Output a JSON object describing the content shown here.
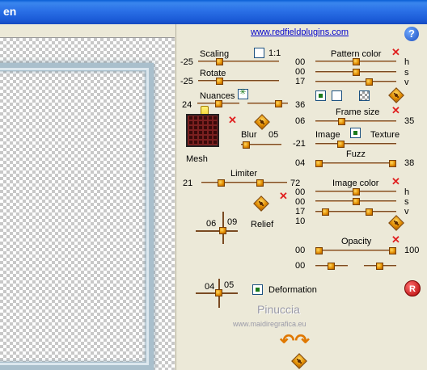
{
  "window": {
    "title": "en"
  },
  "header": {
    "link": "www.redfieldplugins.com",
    "help_label": "?"
  },
  "left": {
    "scaling": {
      "label": "Scaling",
      "min": "-25",
      "value": 0.48,
      "checkbox_label": "1:1"
    },
    "rotate": {
      "label": "Rotate",
      "min": "-25",
      "value": 0.48
    },
    "nuances": {
      "label": "Nuances",
      "left_value": "24",
      "right_value": "36",
      "value_a": 0.18,
      "value_b": 0.82
    },
    "mesh_label": "Mesh",
    "blur": {
      "label": "Blur",
      "value_text": "05",
      "value": 0.05
    },
    "limiter": {
      "label": "Limiter",
      "min": "21",
      "max": "72",
      "value_a": 0.28,
      "value_b": 0.66
    },
    "relief": {
      "label": "Relief",
      "x": "06",
      "y": "09"
    },
    "deform": {
      "label": "Deformation",
      "x": "04",
      "y": "05"
    }
  },
  "right": {
    "pattern_color": {
      "title": "Pattern color",
      "rows": [
        {
          "value": "00",
          "channel": "h",
          "pos": 0.5
        },
        {
          "value": "00",
          "channel": "s",
          "pos": 0.5
        },
        {
          "value": "17",
          "channel": "v",
          "pos": 0.66
        }
      ]
    },
    "frame_size": {
      "title": "Frame size",
      "left": "06",
      "right": "35",
      "pos": 0.2
    },
    "image_label": "Image",
    "texture_label": "Texture",
    "mix_left": "-21",
    "mix_pos": 0.32,
    "fuzz": {
      "title": "Fuzz",
      "left": "04",
      "right": "38",
      "pos_a": 0.02,
      "pos_b": 0.98
    },
    "image_color": {
      "title": "Image color",
      "rows": [
        {
          "value": "00",
          "channel": "h",
          "pos": 0.5
        },
        {
          "value": "00",
          "channel": "s",
          "pos": 0.5
        },
        {
          "value": "17",
          "channel": "v",
          "pos": 0.66
        }
      ],
      "extra": "10"
    },
    "opacity": {
      "title": "Opacity",
      "left": "00",
      "right": "100",
      "row2_left": "00",
      "pos": 0.98
    }
  },
  "footer": {
    "signature": "Pinuccia",
    "signature_url": "www.maidiregrafica.eu",
    "reset_label": "R"
  },
  "colors": {
    "accent": "#e08a00",
    "link": "#0000cc",
    "close": "#e02020"
  }
}
